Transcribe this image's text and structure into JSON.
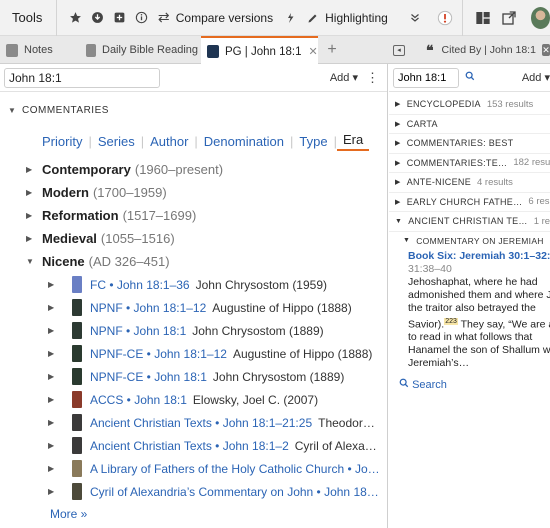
{
  "toolbar": {
    "tools_label": "Tools",
    "compare_label": "Compare versions",
    "highlighting_label": "Highlighting",
    "icons": [
      "star-icon",
      "download-icon",
      "plus-square-icon",
      "info-icon",
      "compare-icon",
      "highlighter-icon",
      "pen-icon",
      "chevron-double-down-icon",
      "alert-icon",
      "layout-icon",
      "popout-icon",
      "avatar"
    ]
  },
  "tabs": [
    {
      "label": "Notes"
    },
    {
      "label": "Daily Bible Reading"
    },
    {
      "label": "PG | John 18:1",
      "active": true
    },
    {
      "label": "Cited By | John 18:1"
    }
  ],
  "left": {
    "reference": "John 18:1",
    "add_label": "Add",
    "section_title": "COMMENTARIES",
    "sort_options": [
      "Priority",
      "Series",
      "Author",
      "Denomination",
      "Type",
      "Era"
    ],
    "active_sort": "Era",
    "eras": [
      {
        "name": "Contemporary",
        "range": "(1960–present)"
      },
      {
        "name": "Modern",
        "range": "(1700–1959)"
      },
      {
        "name": "Reformation",
        "range": "(1517–1699)"
      },
      {
        "name": "Medieval",
        "range": "(1055–1516)"
      },
      {
        "name": "Nicene",
        "range": "(AD 326–451)"
      }
    ],
    "results": [
      {
        "title": "FC • John 18:1–36",
        "author": "John Chrysostom (1959)",
        "color": "#6a7fc4"
      },
      {
        "title": "NPNF • John 18:1–12",
        "author": "Augustine of Hippo (1888)",
        "color": "#2d3a33"
      },
      {
        "title": "NPNF • John 18:1",
        "author": "John Chrysostom (1889)",
        "color": "#2d3a33"
      },
      {
        "title": "NPNF-CE • John 18:1–12",
        "author": "Augustine of Hippo (1888)",
        "color": "#2a3a2f"
      },
      {
        "title": "NPNF-CE • John 18:1",
        "author": "John Chrysostom (1889)",
        "color": "#2a3a2f"
      },
      {
        "title": "ACCS • John 18:1",
        "author": "Elowsky, Joel C. (2007)",
        "color": "#8a3a2a"
      },
      {
        "title": "Ancient Christian Texts • John 18:1–21:25",
        "author": "Theodor…",
        "color": "#3b3a3a"
      },
      {
        "title": "Ancient Christian Texts • John 18:1–2",
        "author": "Cyril of Alexa…",
        "color": "#3b3a3a"
      },
      {
        "title": "A Library of Fathers of the Holy Catholic Church • Jo…",
        "author": "",
        "color": "#8a7a5a"
      },
      {
        "title": "Cyril of Alexandria’s Commentary on John • John 18…",
        "author": "",
        "color": "#4d4a3a"
      }
    ],
    "more_label": "More »"
  },
  "right": {
    "reference": "John 18:1",
    "add_label": "Add",
    "categories": [
      {
        "label": "ENCYCLOPEDIA",
        "count": "153 results"
      },
      {
        "label": "CARTA",
        "count": ""
      },
      {
        "label": "COMMENTARIES: BEST",
        "count": ""
      },
      {
        "label": "COMMENTARIES:TE…",
        "count": "182 results"
      },
      {
        "label": "ANTE-NICENE",
        "count": "4 results"
      },
      {
        "label": "EARLY CHURCH FATHE…",
        "count": "6 result"
      },
      {
        "label": "ANCIENT CHRISTIAN TE…",
        "count": "1 resul"
      }
    ],
    "sub_label": "COMMENTARY ON JEREMIAH",
    "sub_count": "1",
    "book_title": "Book Six: Jeremiah 30:1–32:34",
    "verse": "31:38–40",
    "excerpt_1": "Jehoshaphat, where he had admonished them and where Ju the traitor also betrayed the Savior).",
    "footnote": "223",
    "excerpt_2": " They say, “We are ab to read in what follows that Hanamel the son of Shallum wa Jeremiah’s…",
    "search_label": "Search"
  },
  "colors": {
    "accent": "#e56b1f",
    "link": "#2b64b5"
  }
}
